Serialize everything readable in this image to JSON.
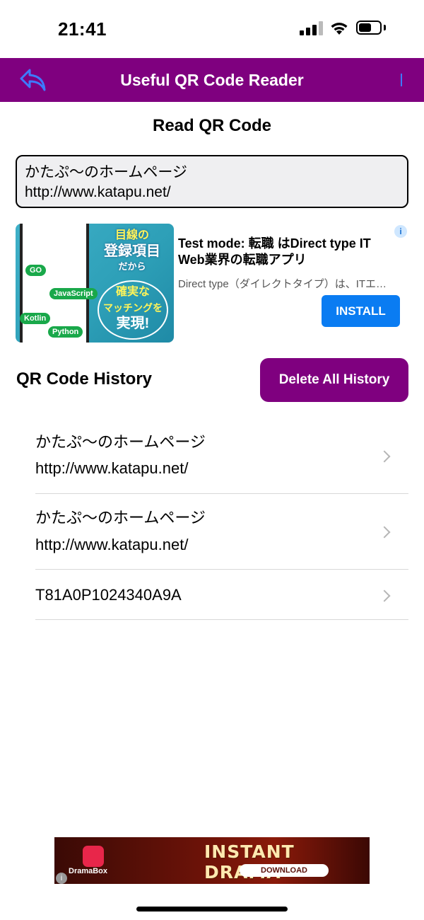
{
  "status_bar": {
    "time": "21:41"
  },
  "navbar": {
    "title": "Useful QR Code Reader",
    "back_icon": "undo-arrow-icon",
    "color": "#7f007f"
  },
  "read_section": {
    "title": "Read QR Code",
    "result_lines": [
      "かたぷ〜のホームページ",
      "http://www.katapu.net/"
    ]
  },
  "ad": {
    "image_text": {
      "top": "目線の",
      "main": "登録項目",
      "mid": "だから",
      "circle": [
        "確実な",
        "マッチングを",
        "実現!"
      ]
    },
    "chips": [
      "GO",
      "JavaScript",
      "Kotlin",
      "Python"
    ],
    "headline": "Test mode: 転職 はDirect type IT Web業界の転職アプリ",
    "body": "Direct type（ダイレクトタイプ）は、ITエ…",
    "install_label": "INSTALL",
    "info_icon": "info-icon"
  },
  "history": {
    "title": "QR Code History",
    "delete_label": "Delete All History",
    "items": [
      {
        "lines": [
          "かたぷ〜のホームページ",
          "http://www.katapu.net/"
        ]
      },
      {
        "lines": [
          "かたぷ〜のホームページ",
          "http://www.katapu.net/"
        ]
      },
      {
        "lines": [
          "T81A0P1024340A9A"
        ]
      }
    ]
  },
  "banner_ad": {
    "brand": "DramaBox",
    "headline": "INSTANT DRAMA",
    "cta": "DOWNLOAD"
  },
  "colors": {
    "accent": "#7f007f",
    "install": "#0a7cf2",
    "chevron": "#b6b6b6"
  }
}
